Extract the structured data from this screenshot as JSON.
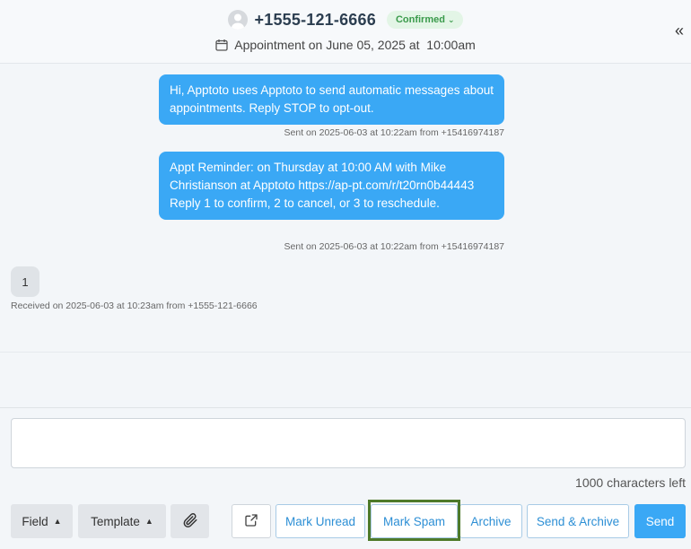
{
  "header": {
    "phone": "+1555-121-6666",
    "status_badge": "Confirmed",
    "appointment": "Appointment on June 05, 2025 at  10:00am"
  },
  "messages": [
    {
      "direction": "outgoing",
      "text": "Hi, Apptoto uses Apptoto to send automatic messages about appointments. Reply STOP to opt-out.",
      "meta": "Sent on 2025-06-03 at 10:22am from +15416974187"
    },
    {
      "direction": "outgoing",
      "text": "Appt Reminder: on Thursday at 10:00 AM with Mike Christianson at Apptoto https://ap-pt.com/r/t20rn0b44443 Reply 1 to confirm, 2 to cancel, or 3 to reschedule.",
      "meta": "Sent on 2025-06-03 at 10:22am from +15416974187"
    },
    {
      "direction": "incoming",
      "text": "1",
      "meta": "Received on 2025-06-03 at 10:23am from +1555-121-6666"
    }
  ],
  "composer": {
    "value": "",
    "chars_left": "1000 characters left"
  },
  "toolbar": {
    "field_label": "Field",
    "template_label": "Template",
    "mark_unread_label": "Mark Unread",
    "mark_spam_label": "Mark Spam",
    "archive_label": "Archive",
    "send_archive_label": "Send & Archive",
    "send_label": "Send"
  },
  "icons": {
    "avatar": "user-avatar-icon",
    "calendar": "calendar-icon",
    "collapse": "double-chevron-left-icon",
    "attach": "paperclip-icon",
    "external": "external-link-icon"
  },
  "colors": {
    "accent": "#3aa8f5",
    "badge_bg": "#e3f5e6",
    "badge_text": "#3a9a4b",
    "highlight": "#4e7a2a"
  }
}
